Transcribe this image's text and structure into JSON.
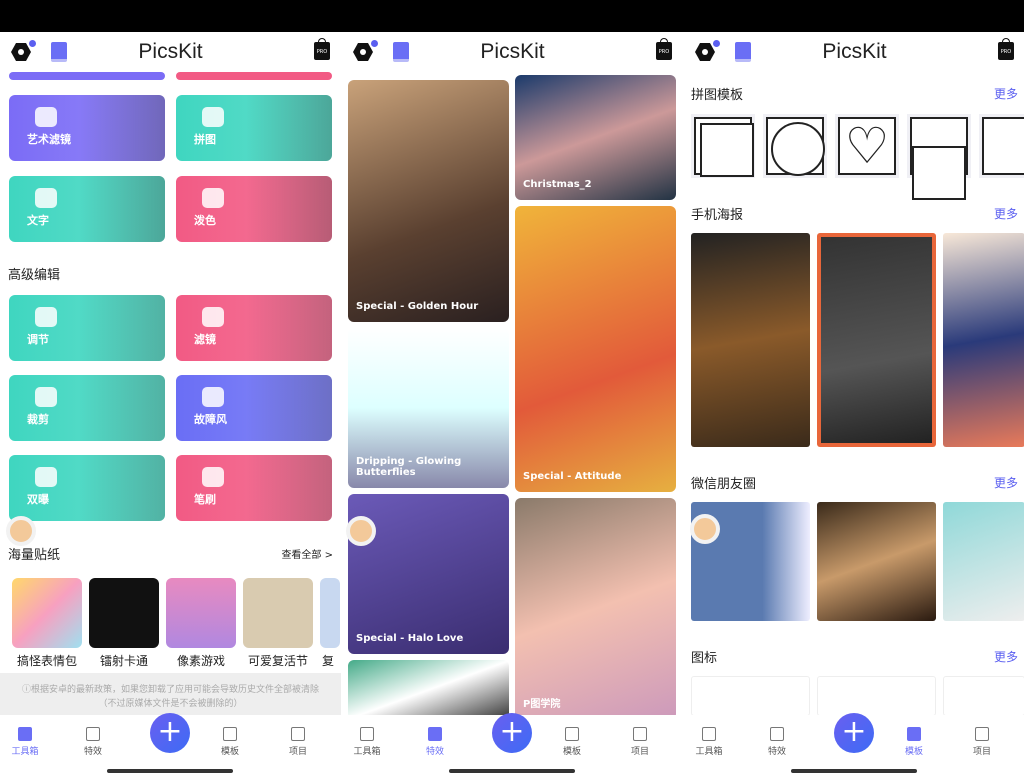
{
  "app_title": "PicsKit",
  "pro_badge": "PRO",
  "toolbox": {
    "cards": [
      {
        "label": "艺术滤镜",
        "color": "#7b6cf6"
      },
      {
        "label": "拼图",
        "color": "#3fd6c0"
      },
      {
        "label": "文字",
        "color": "#3fd6c0"
      },
      {
        "label": "泼色",
        "color": "#f25a84"
      }
    ],
    "advanced_title": "高级编辑",
    "advanced": [
      {
        "label": "调节",
        "color": "#3fd6c0"
      },
      {
        "label": "滤镜",
        "color": "#f25a84"
      },
      {
        "label": "裁剪",
        "color": "#3fd6c0"
      },
      {
        "label": "故障风",
        "color": "#6a6ef5"
      },
      {
        "label": "双曝",
        "color": "#3fd6c0"
      },
      {
        "label": "笔刷",
        "color": "#f25a84"
      }
    ],
    "stickers_title": "海量贴纸",
    "view_all": "查看全部 >",
    "stickers": [
      "搞怪表情包",
      "镭射卡通",
      "像素游戏",
      "可爱复活节",
      "复"
    ],
    "notice_line1": "ⓘ根据安卓的最新政策，如果您卸载了应用可能会导致历史文件全部被清除",
    "notice_line2": "（不过原媒体文件是不会被删除的）"
  },
  "effects": {
    "left": [
      "Special - Golden Hour",
      "Dripping - Glowing Butterflies",
      "Special - Halo Love"
    ],
    "right": [
      "Christmas_2",
      "Special - Attitude",
      "P图学院"
    ]
  },
  "templates": {
    "more": "更多",
    "sections": [
      "拼图模板",
      "手机海报",
      "微信朋友圈",
      "图标"
    ],
    "shapes": [
      "square",
      "circle",
      "heart",
      "split-horizontal",
      "split-vertical"
    ]
  },
  "nav": [
    "工具箱",
    "特效",
    "模板",
    "项目"
  ],
  "accent": "#6a6ef5"
}
